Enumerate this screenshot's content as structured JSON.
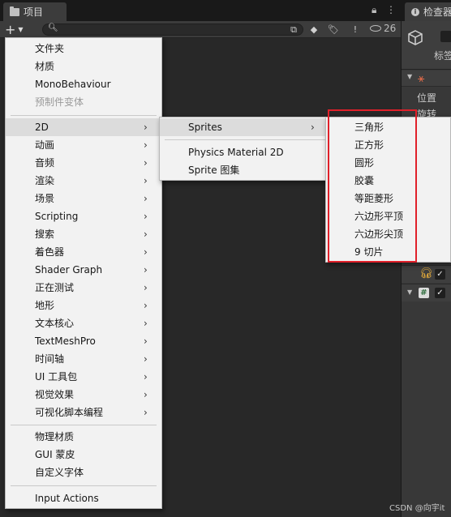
{
  "project_window": {
    "tab_title": "项目",
    "search_placeholder": "",
    "hidden_count": "26"
  },
  "inspector_window": {
    "tab_title": "检查器",
    "tag_label": "标签",
    "position_label": "位置",
    "rotation_label": "旋转"
  },
  "main_menu": {
    "items": [
      {
        "label": "文件夹"
      },
      {
        "label": "材质"
      },
      {
        "label": "MonoBehaviour"
      },
      {
        "label": "预制件变体"
      },
      {
        "label": "2D"
      },
      {
        "label": "动画"
      },
      {
        "label": "音频"
      },
      {
        "label": "渲染"
      },
      {
        "label": "场景"
      },
      {
        "label": "Scripting"
      },
      {
        "label": "搜索"
      },
      {
        "label": "着色器"
      },
      {
        "label": "Shader Graph"
      },
      {
        "label": "正在测试"
      },
      {
        "label": "地形"
      },
      {
        "label": "文本核心"
      },
      {
        "label": "TextMeshPro"
      },
      {
        "label": "时间轴"
      },
      {
        "label": "UI 工具包"
      },
      {
        "label": "视觉效果"
      },
      {
        "label": "可视化脚本编程"
      },
      {
        "label": "物理材质"
      },
      {
        "label": "GUI 蒙皮"
      },
      {
        "label": "自定义字体"
      },
      {
        "label": "Input Actions"
      }
    ]
  },
  "submenu_2d": {
    "items": [
      {
        "label": "Sprites"
      },
      {
        "label": "Physics Material 2D"
      },
      {
        "label": "Sprite 图集"
      }
    ]
  },
  "submenu_sprites": {
    "items": [
      {
        "label": "三角形"
      },
      {
        "label": "正方形"
      },
      {
        "label": "圆形"
      },
      {
        "label": "胶囊"
      },
      {
        "label": "等距菱形"
      },
      {
        "label": "六边形平顶"
      },
      {
        "label": "六边形尖顶"
      },
      {
        "label": "9 切片"
      }
    ]
  },
  "watermark": "CSDN @向宇it",
  "colors": {
    "annotation_box": "#e0202a",
    "menu_bg": "#f2f2f2",
    "editor_bg": "#282828"
  }
}
